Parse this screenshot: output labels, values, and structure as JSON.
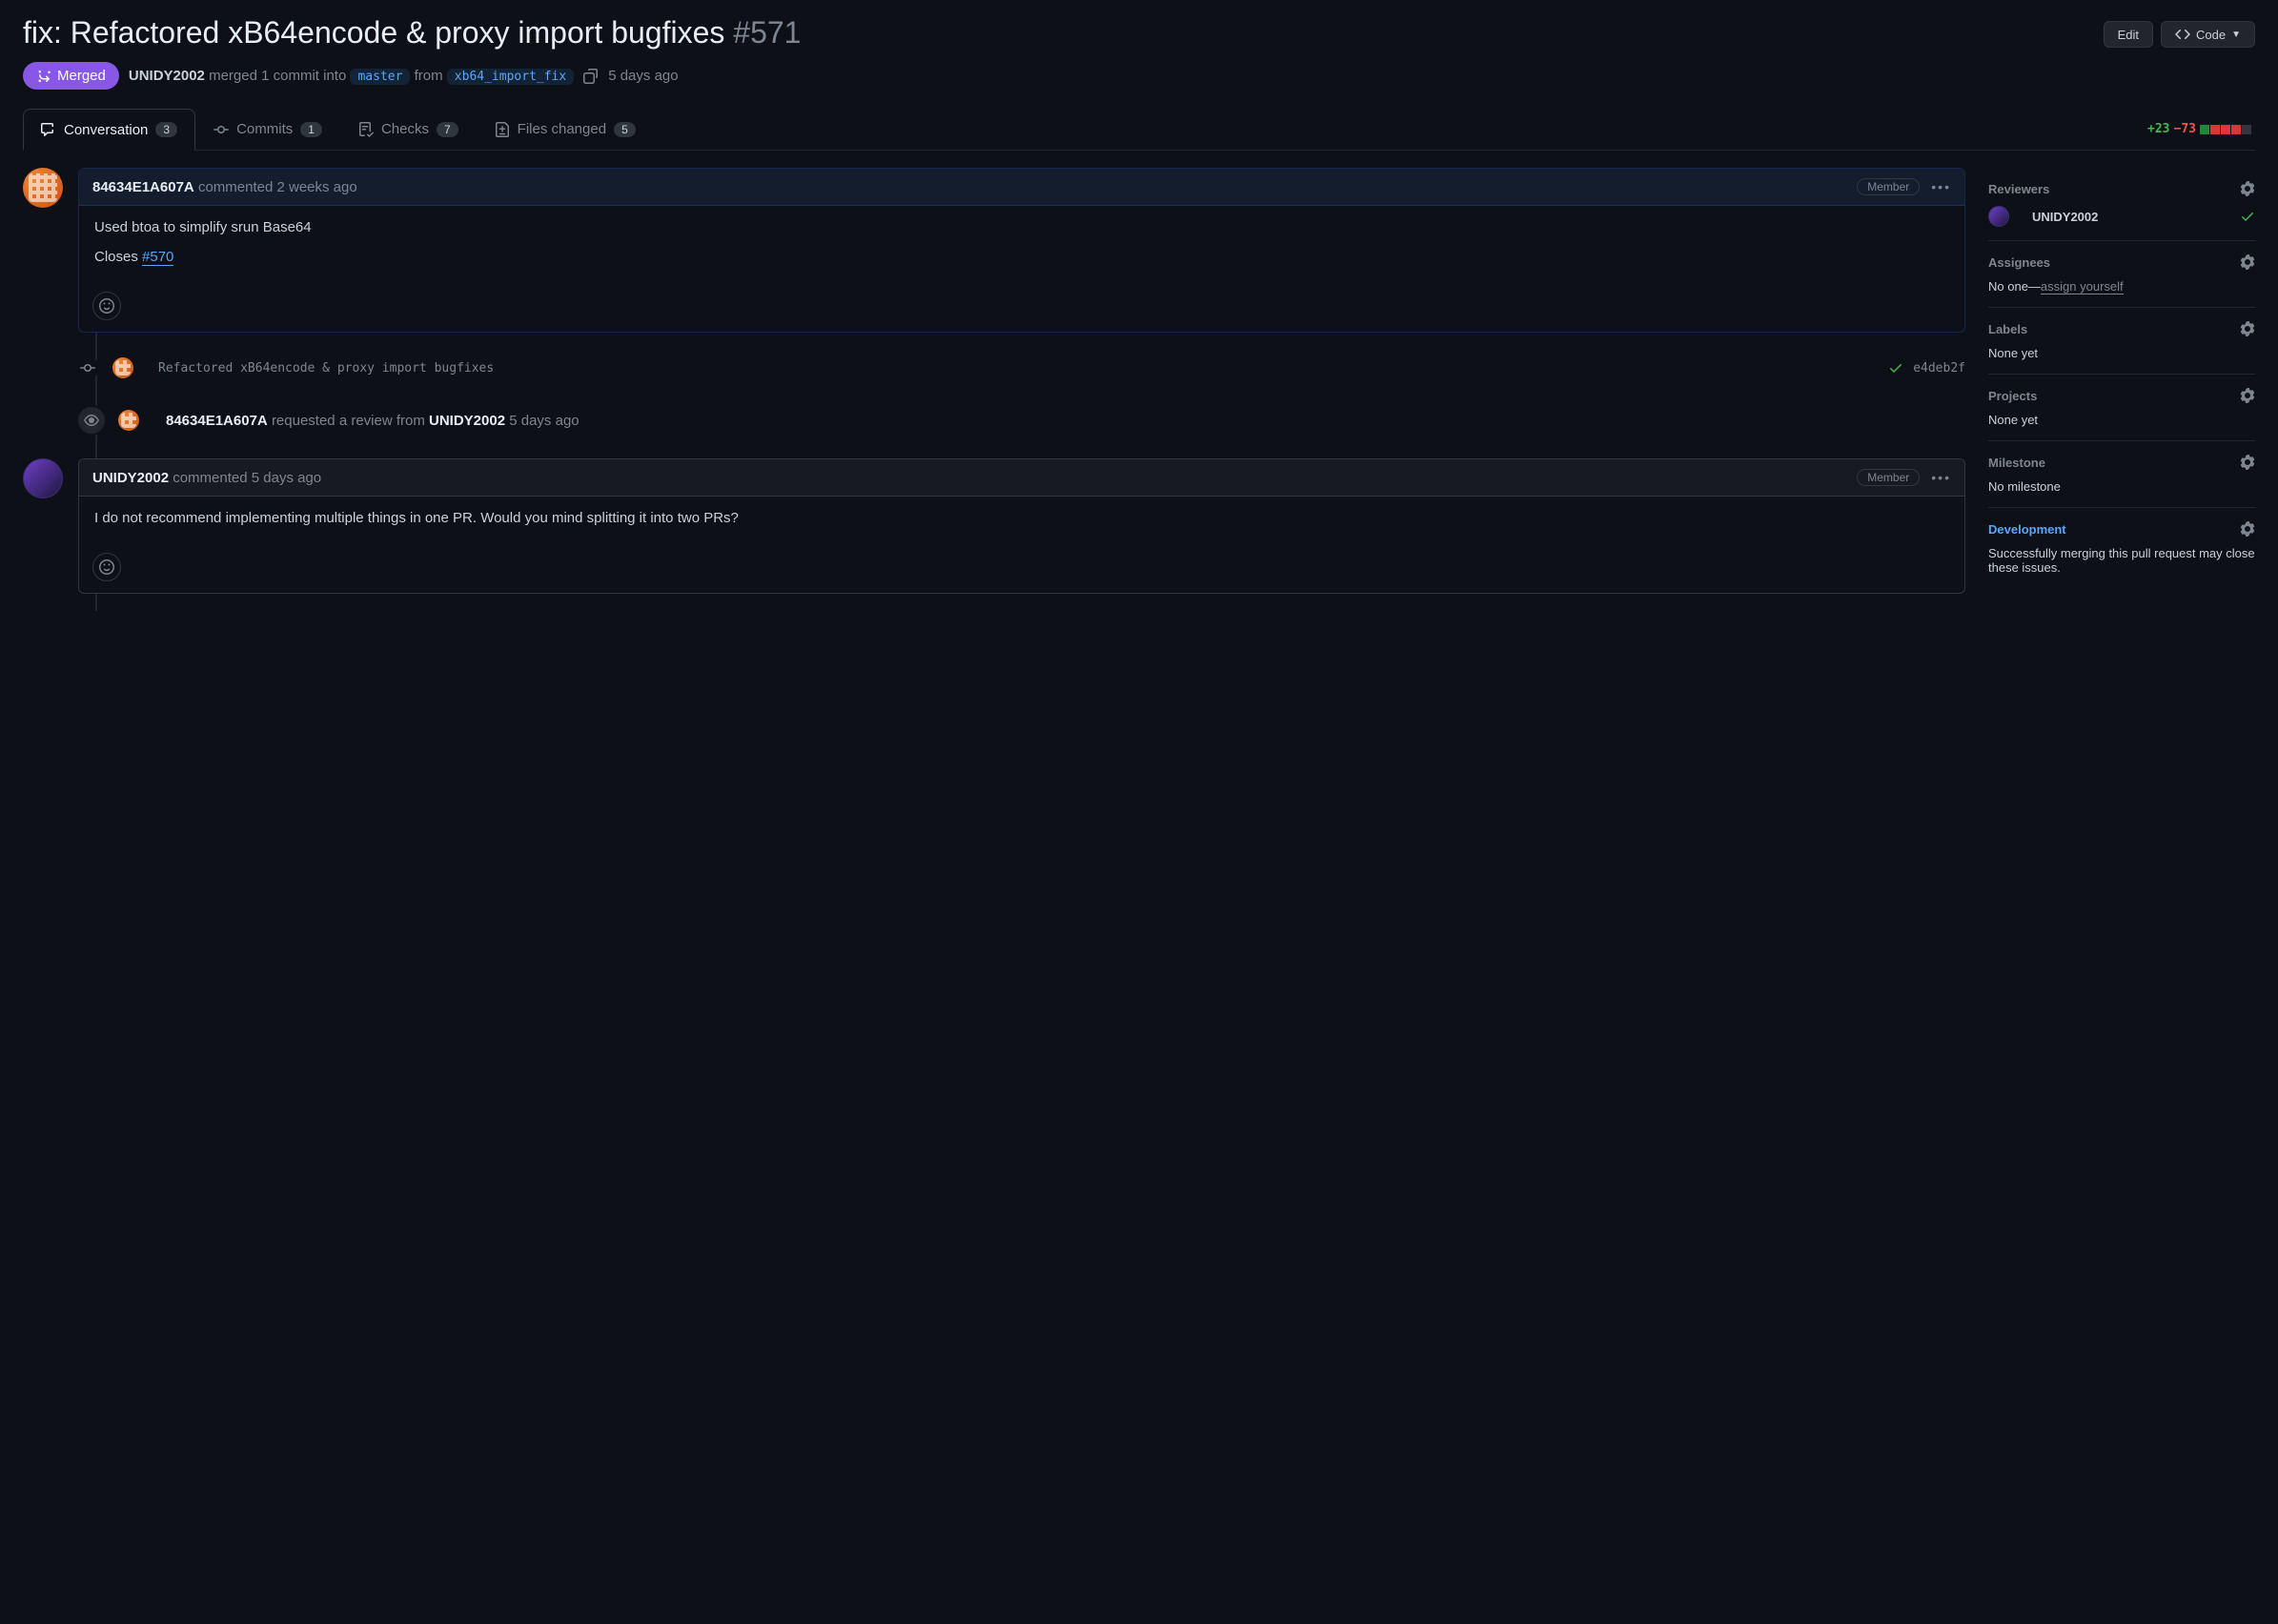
{
  "header": {
    "title": "fix: Refactored xB64encode & proxy import bugfixes",
    "number": "#571",
    "edit_label": "Edit",
    "code_label": "Code"
  },
  "state": {
    "label": "Merged",
    "actor": "UNIDY2002",
    "action1": "merged 1 commit into",
    "base": "master",
    "from_word": "from",
    "head": "xb64_import_fix",
    "time": "5 days ago"
  },
  "tabs": {
    "conversation": {
      "label": "Conversation",
      "count": "3"
    },
    "commits": {
      "label": "Commits",
      "count": "1"
    },
    "checks": {
      "label": "Checks",
      "count": "7"
    },
    "files": {
      "label": "Files changed",
      "count": "5"
    }
  },
  "diffstat": {
    "add": "+23",
    "del": "−73"
  },
  "comment1": {
    "author": "84634E1A607A",
    "verb": "commented",
    "time": "2 weeks ago",
    "role": "Member",
    "body_line1": "Used btoa to simplify srun Base64",
    "closes_prefix": "Closes ",
    "closes_link": "#570"
  },
  "commit1": {
    "message": "Refactored xB64encode & proxy import bugfixes",
    "hash": "e4deb2f"
  },
  "event1": {
    "actor": "84634E1A607A",
    "action": "requested a review from",
    "target": "UNIDY2002",
    "time": "5 days ago"
  },
  "comment2": {
    "author": "UNIDY2002",
    "verb": "commented",
    "time": "5 days ago",
    "role": "Member",
    "body": "I do not recommend implementing multiple things in one PR. Would you mind splitting it into two PRs?"
  },
  "sidebar": {
    "reviewers": {
      "title": "Reviewers",
      "name": "UNIDY2002"
    },
    "assignees": {
      "title": "Assignees",
      "noone": "No one—",
      "assign": "assign yourself"
    },
    "labels": {
      "title": "Labels",
      "none": "None yet"
    },
    "projects": {
      "title": "Projects",
      "none": "None yet"
    },
    "milestone": {
      "title": "Milestone",
      "none": "No milestone"
    },
    "development": {
      "title": "Development",
      "text": "Successfully merging this pull request may close these issues."
    }
  }
}
